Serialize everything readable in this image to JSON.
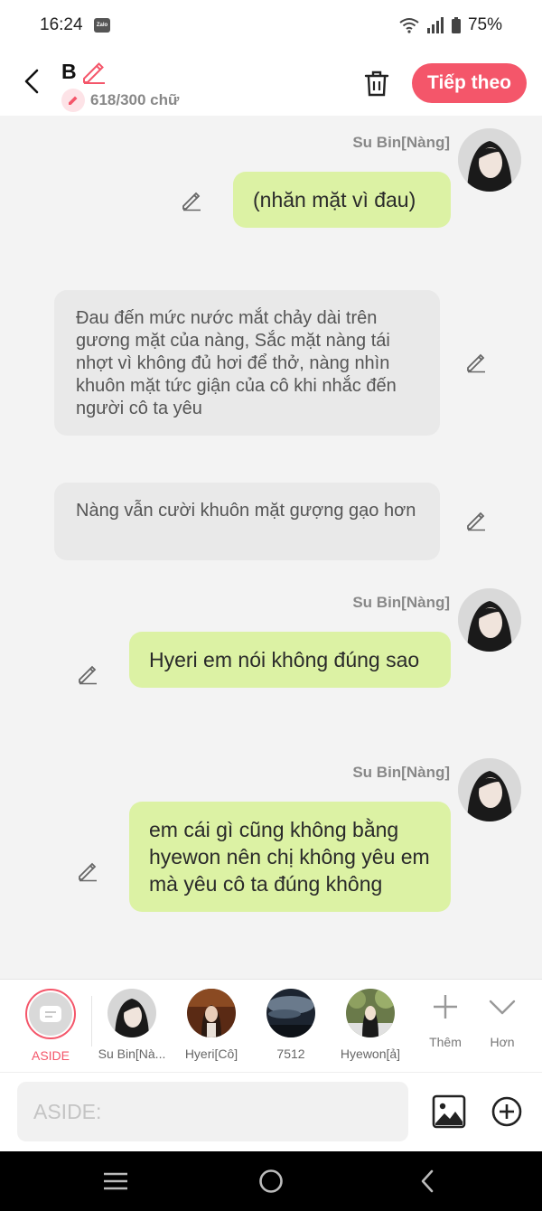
{
  "status": {
    "time": "16:24",
    "battery": "75%"
  },
  "header": {
    "title": "B",
    "count": "618/300 chữ",
    "next_label": "Tiếp theo"
  },
  "messages": [
    {
      "type": "me",
      "name": "Su Bin[Nàng]",
      "text": "(nhăn mặt vì đau)"
    },
    {
      "type": "narration",
      "text": "Đau đến mức nước mắt chảy dài trên gương mặt của nàng, Sắc mặt nàng tái nhợt vì không đủ hơi để thở, nàng nhìn khuôn mặt tức giận của cô khi nhắc đến người cô ta yêu"
    },
    {
      "type": "narration",
      "text": "Nàng vẫn cười khuôn mặt gượng gạo hơn"
    },
    {
      "type": "me",
      "name": "Su Bin[Nàng]",
      "text": "Hyeri em nói không đúng sao"
    },
    {
      "type": "me",
      "name": "Su Bin[Nàng]",
      "text": "em cái gì cũng không bằng hyewon nên chị không yêu em mà yêu cô ta đúng không"
    }
  ],
  "characters": [
    {
      "label": "ASIDE"
    },
    {
      "label": "Su Bin[Nà..."
    },
    {
      "label": "Hyeri[Cô]"
    },
    {
      "label": "7512"
    },
    {
      "label": "Hyewon[ả]"
    }
  ],
  "tools": {
    "add_label": "Thêm",
    "more_label": "Hơn"
  },
  "input": {
    "placeholder": "ASIDE:"
  },
  "colors": {
    "accent": "#f4566a",
    "my_bubble": "#dcf2a4",
    "narration_bubble": "#e9e9e9"
  }
}
